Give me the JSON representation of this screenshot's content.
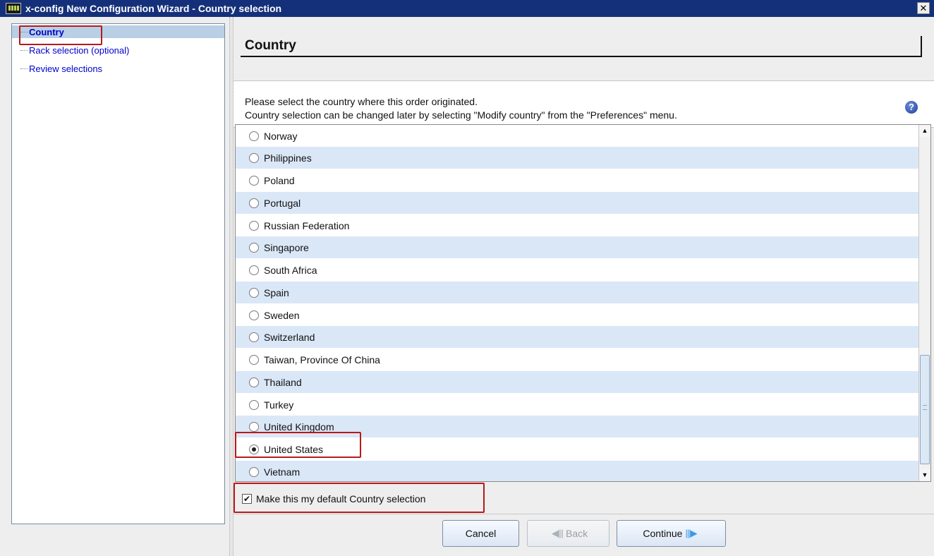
{
  "window": {
    "title": "x-config New Configuration Wizard - Country selection",
    "close_glyph": "✕"
  },
  "tree": {
    "items": [
      {
        "label": "Country",
        "selected": true
      },
      {
        "label": "Rack selection (optional)",
        "selected": false
      },
      {
        "label": "Review selections",
        "selected": false
      }
    ]
  },
  "main": {
    "section_title": "Country",
    "instructions": [
      "Please select the country where this order originated.",
      "Country selection can be changed later by selecting \"Modify country\" from the \"Preferences\" menu."
    ],
    "help_glyph": "?"
  },
  "country_list": {
    "items": [
      {
        "name": "Norway",
        "selected": false
      },
      {
        "name": "Philippines",
        "selected": false
      },
      {
        "name": "Poland",
        "selected": false
      },
      {
        "name": "Portugal",
        "selected": false
      },
      {
        "name": "Russian Federation",
        "selected": false
      },
      {
        "name": "Singapore",
        "selected": false
      },
      {
        "name": "South Africa",
        "selected": false
      },
      {
        "name": "Spain",
        "selected": false
      },
      {
        "name": "Sweden",
        "selected": false
      },
      {
        "name": "Switzerland",
        "selected": false
      },
      {
        "name": "Taiwan, Province Of China",
        "selected": false
      },
      {
        "name": "Thailand",
        "selected": false
      },
      {
        "name": "Turkey",
        "selected": false
      },
      {
        "name": "United Kingdom",
        "selected": false
      },
      {
        "name": "United States",
        "selected": true
      },
      {
        "name": "Vietnam",
        "selected": false
      }
    ],
    "alt_row_color": "#dae7f7"
  },
  "default_checkbox": {
    "label": "Make this my default Country selection",
    "checked": true,
    "check_glyph": "✔"
  },
  "buttons": {
    "cancel": "Cancel",
    "back": "Back",
    "continue": "Continue"
  },
  "colors": {
    "titlebar": "#15307a",
    "highlight_box": "#b8191a",
    "tree_link": "#0000cc",
    "selection": "#b8cfe5"
  }
}
